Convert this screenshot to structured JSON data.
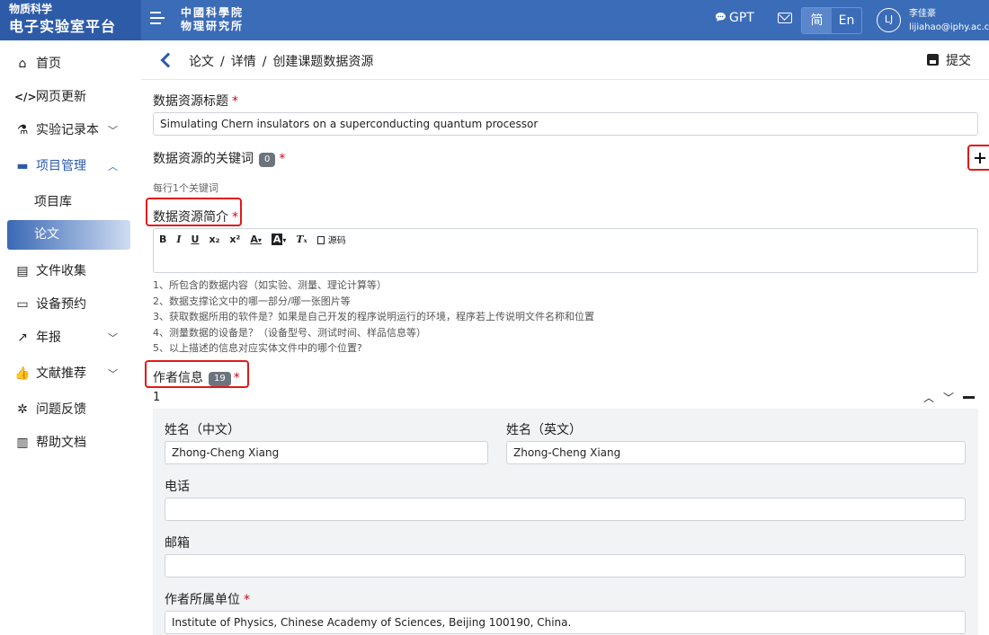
{
  "brand": {
    "line1": "物质科学",
    "line2": "电子实验室平台"
  },
  "header": {
    "org_line1": "中國科學院",
    "org_line2": "物理研究所",
    "gpt_label": "GPT",
    "lang_options": [
      "简",
      "En"
    ],
    "lang_selected": "简",
    "user_initials": "LJ",
    "user_name": "李佳豪",
    "user_email": "lijiahao@iphy.ac.cn"
  },
  "sidebar": {
    "items": [
      {
        "label": "首页",
        "icon": "home-icon"
      },
      {
        "label": "网页更新",
        "icon": "code-icon"
      },
      {
        "label": "实验记录本",
        "icon": "microscope-icon"
      },
      {
        "label": "项目管理",
        "icon": "folder-icon"
      },
      {
        "label": "项目库"
      },
      {
        "label": "论文"
      },
      {
        "label": "文件收集",
        "icon": "file-collect-icon"
      },
      {
        "label": "设备预约",
        "icon": "device-icon"
      },
      {
        "label": "年报",
        "icon": "chart-line-icon"
      },
      {
        "label": "文献推荐",
        "icon": "thumbs-up-icon"
      },
      {
        "label": "问题反馈",
        "icon": "bug-icon"
      },
      {
        "label": "帮助文档",
        "icon": "book-icon"
      }
    ]
  },
  "breadcrumb": {
    "items": [
      "论文",
      "详情",
      "创建课题数据资源"
    ],
    "separator": "/"
  },
  "toolbar": {
    "submit_label": "提交"
  },
  "form": {
    "title_label": "数据资源标题",
    "title_value": "Simulating Chern insulators on a superconducting quantum processor",
    "keywords_label": "数据资源的关键词",
    "keywords_count": "0",
    "keywords_hint": "每行1个关键词",
    "summary_label": "数据资源简介",
    "editor_tools": {
      "bold": "B",
      "italic": "I",
      "underline": "U",
      "subscript": "x₂",
      "superscript": "x²",
      "font_color": "A",
      "bg_color": "A",
      "clear_format": "Tₓ",
      "source": "源码"
    },
    "summary_guidance": [
      "1、所包含的数据内容（如实验、测量、理论计算等）",
      "2、数据支撑论文中的哪一部分/哪一张图片等",
      "3、获取数据所用的软件是？如果是自己开发的程序说明运行的环境，程序若上传说明文件名称和位置",
      "4、测量数据的设备是？（设备型号、测试时间、样品信息等）",
      "5、以上描述的信息对应实体文件中的哪个位置?"
    ],
    "authors_label": "作者信息",
    "authors_count": "19",
    "author_index": "1",
    "author": {
      "name_cn_label": "姓名（中文）",
      "name_cn_value": "Zhong-Cheng Xiang",
      "name_en_label": "姓名（英文）",
      "name_en_value": "Zhong-Cheng Xiang",
      "phone_label": "电话",
      "phone_value": "",
      "email_label": "邮箱",
      "email_value": "",
      "affiliation_label": "作者所属单位",
      "affiliation_value": "Institute of Physics, Chinese Academy of Sciences, Beijing 100190, China."
    }
  },
  "required_mark": "*",
  "colors": {
    "brand": "#2e5ba8",
    "header": "#3b6cb7",
    "highlight": "#e01919",
    "badge": "#6c757d"
  }
}
